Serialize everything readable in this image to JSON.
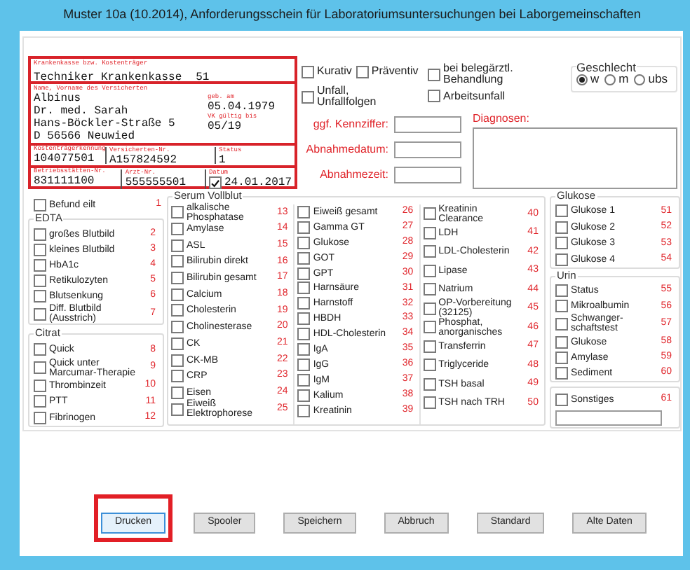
{
  "window": {
    "title": "Muster 10a (10.2014), Anforderungsschein für Laboratoriumsuntersuchungen bei Laborgemeinschaften"
  },
  "card": {
    "insurer": {
      "label": "Krankenkasse bzw. Kostenträger",
      "name": "Techniker Krankenkasse",
      "number": "51"
    },
    "person": {
      "label": "Name, Vorname des Versicherten",
      "lines": [
        "Albinus",
        "Dr. med. Sarah",
        "Hans-Böckler-Straße 5",
        "D 56566 Neuwied"
      ],
      "birth_label": "geb. am",
      "birth": "05.04.1979",
      "valid_label": "VK gültig bis",
      "valid": "05/19"
    },
    "ids": [
      {
        "label": "Kostenträgerkennung",
        "value": "104077501"
      },
      {
        "label": "Versicherten-Nr.",
        "value": "A157824592"
      },
      {
        "label": "Status",
        "value": "1"
      }
    ],
    "practice": [
      {
        "label": "Betriebsstätten-Nr.",
        "value": "831111100"
      },
      {
        "label": "Arzt-Nr.",
        "value": "555555501"
      }
    ],
    "date": {
      "label": "Datum",
      "value": "24.01.2017",
      "checked": true
    }
  },
  "options": [
    {
      "label": "Kurativ",
      "checked": false
    },
    {
      "label": "Präventiv",
      "checked": false
    },
    {
      "label": "bei belegärztl.\nBehandlung",
      "checked": false
    },
    {
      "label": "Unfall,\nUnfallfolgen",
      "checked": false
    },
    {
      "label": "Arbeitsunfall",
      "checked": false
    }
  ],
  "gender": {
    "title": "Geschlecht",
    "options": [
      {
        "label": "w",
        "selected": true
      },
      {
        "label": "m",
        "selected": false
      },
      {
        "label": "ubs",
        "selected": false
      }
    ]
  },
  "fields": [
    {
      "label": "ggf. Kennziffer:"
    },
    {
      "label": "Abnahmedatum:"
    },
    {
      "label": "Abnahmezeit:"
    }
  ],
  "diagnoses": {
    "label": "Diagnosen:"
  },
  "tests": {
    "left": {
      "urgent": {
        "label": "Befund eilt",
        "number": "1",
        "checked": false
      },
      "groups": [
        {
          "title": "EDTA",
          "items": [
            {
              "label": "großes Blutbild",
              "number": "2",
              "checked": false
            },
            {
              "label": "kleines Blutbild",
              "number": "3",
              "checked": false
            },
            {
              "label": "HbA1c",
              "number": "4",
              "checked": false
            },
            {
              "label": "Retikulozyten",
              "number": "5",
              "checked": false
            },
            {
              "label": "Blutsenkung",
              "number": "6",
              "checked": false
            },
            {
              "label": "Diff. Blutbild\n(Ausstrich)",
              "number": "7",
              "checked": false
            }
          ]
        },
        {
          "title": "Citrat",
          "items": [
            {
              "label": "Quick",
              "number": "8",
              "checked": false
            },
            {
              "label": "Quick unter\nMarcumar-Therapie",
              "number": "9",
              "checked": false
            },
            {
              "label": "Thrombinzeit",
              "number": "10",
              "checked": false
            },
            {
              "label": "PTT",
              "number": "11",
              "checked": false
            },
            {
              "label": "Fibrinogen",
              "number": "12",
              "checked": false
            }
          ]
        }
      ]
    },
    "serum": {
      "title": "Serum Vollblut",
      "columns": [
        [
          {
            "label": "alkalische\nPhosphatase",
            "number": "13",
            "checked": false
          },
          {
            "label": "Amylase",
            "number": "14",
            "checked": false
          },
          {
            "label": "ASL",
            "number": "15",
            "checked": false
          },
          {
            "label": "Bilirubin direkt",
            "number": "16",
            "checked": false
          },
          {
            "label": "Bilirubin gesamt",
            "number": "17",
            "checked": false
          },
          {
            "label": "Calcium",
            "number": "18",
            "checked": false
          },
          {
            "label": "Cholesterin",
            "number": "19",
            "checked": false
          },
          {
            "label": "Cholinesterase",
            "number": "20",
            "checked": false
          },
          {
            "label": "CK",
            "number": "21",
            "checked": false
          },
          {
            "label": "CK-MB",
            "number": "22",
            "checked": false
          },
          {
            "label": "CRP",
            "number": "23",
            "checked": false
          },
          {
            "label": "Eisen",
            "number": "24",
            "checked": false
          },
          {
            "label": "Eiweiß\nElektrophorese",
            "number": "25",
            "checked": false
          }
        ],
        [
          {
            "label": "Eiweiß gesamt",
            "number": "26",
            "checked": false
          },
          {
            "label": "Gamma GT",
            "number": "27",
            "checked": false
          },
          {
            "label": "Glukose",
            "number": "28",
            "checked": false
          },
          {
            "label": "GOT",
            "number": "29",
            "checked": false
          },
          {
            "label": "GPT",
            "number": "30",
            "checked": false
          },
          {
            "label": "Harnsäure",
            "number": "31",
            "checked": false
          },
          {
            "label": "Harnstoff",
            "number": "32",
            "checked": false
          },
          {
            "label": "HBDH",
            "number": "33",
            "checked": false
          },
          {
            "label": "HDL-Cholesterin",
            "number": "34",
            "checked": false
          },
          {
            "label": "IgA",
            "number": "35",
            "checked": false
          },
          {
            "label": "IgG",
            "number": "36",
            "checked": false
          },
          {
            "label": "IgM",
            "number": "37",
            "checked": false
          },
          {
            "label": "Kalium",
            "number": "38",
            "checked": false
          },
          {
            "label": "Kreatinin",
            "number": "39",
            "checked": false
          }
        ],
        [
          {
            "label": "Kreatinin\nClearance",
            "number": "40",
            "checked": false
          },
          {
            "label": "LDH",
            "number": "41",
            "checked": false
          },
          {
            "label": "LDL-Cholesterin",
            "number": "42",
            "checked": false
          },
          {
            "label": "Lipase",
            "number": "43",
            "checked": false
          },
          {
            "label": "Natrium",
            "number": "44",
            "checked": false
          },
          {
            "label": "OP-Vorbereitung\n(32125)",
            "number": "45",
            "checked": false
          },
          {
            "label": "Phosphat,\nanorganisches",
            "number": "46",
            "checked": false
          },
          {
            "label": "Transferrin",
            "number": "47",
            "checked": false
          },
          {
            "label": "Triglyceride",
            "number": "48",
            "checked": false
          },
          {
            "label": "TSH basal",
            "number": "49",
            "checked": false
          },
          {
            "label": "TSH nach TRH",
            "number": "50",
            "checked": false
          }
        ]
      ]
    },
    "right": {
      "groups": [
        {
          "title": "Glukose",
          "items": [
            {
              "label": "Glukose 1",
              "number": "51",
              "checked": false
            },
            {
              "label": "Glukose 2",
              "number": "52",
              "checked": false
            },
            {
              "label": "Glukose 3",
              "number": "53",
              "checked": false
            },
            {
              "label": "Glukose 4",
              "number": "54",
              "checked": false
            }
          ]
        },
        {
          "title": "Urin",
          "items": [
            {
              "label": "Status",
              "number": "55",
              "checked": false
            },
            {
              "label": "Mikroalbumin",
              "number": "56",
              "checked": false
            },
            {
              "label": "Schwanger-\nschaftstest",
              "number": "57",
              "checked": false
            },
            {
              "label": "Glukose",
              "number": "58",
              "checked": false
            },
            {
              "label": "Amylase",
              "number": "59",
              "checked": false
            },
            {
              "label": "Sediment",
              "number": "60",
              "checked": false
            }
          ]
        }
      ],
      "other": {
        "label": "Sonstiges",
        "number": "61",
        "checked": false
      }
    }
  },
  "buttons": [
    {
      "label": "Drucken",
      "focused": true,
      "highlighted": true
    },
    {
      "label": "Spooler",
      "focused": false,
      "highlighted": false
    },
    {
      "label": "Speichern",
      "focused": false,
      "highlighted": false
    },
    {
      "label": "Abbruch",
      "focused": false,
      "highlighted": false
    },
    {
      "label": "Standard",
      "focused": false,
      "highlighted": false
    },
    {
      "label": "Alte Daten",
      "focused": false,
      "highlighted": false
    }
  ]
}
